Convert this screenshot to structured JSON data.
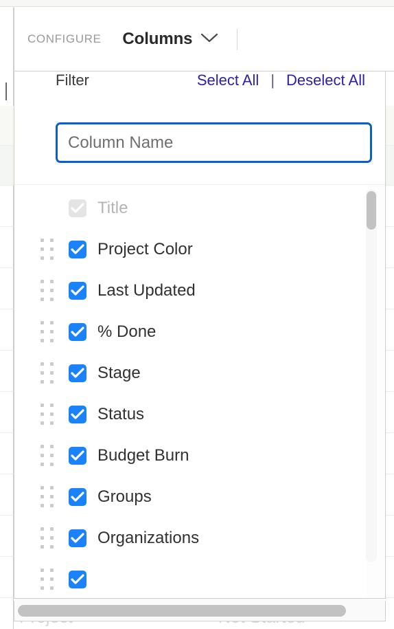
{
  "toolbar": {
    "configure_label": "CONFIGURE",
    "menu_label": "Columns",
    "chevron_icon": "chevron-down-icon"
  },
  "popover": {
    "filter_label": "Filter",
    "select_all_label": "Select All",
    "separator": "|",
    "deselect_all_label": "Deselect All",
    "search": {
      "value": "",
      "placeholder": "Column Name"
    },
    "items": [
      {
        "label": "Title",
        "checked": true,
        "disabled": true,
        "draggable": false
      },
      {
        "label": "Project Color",
        "checked": true,
        "disabled": false,
        "draggable": true
      },
      {
        "label": "Last Updated",
        "checked": true,
        "disabled": false,
        "draggable": true
      },
      {
        "label": "% Done",
        "checked": true,
        "disabled": false,
        "draggable": true
      },
      {
        "label": "Stage",
        "checked": true,
        "disabled": false,
        "draggable": true
      },
      {
        "label": "Status",
        "checked": true,
        "disabled": false,
        "draggable": true
      },
      {
        "label": "Budget Burn",
        "checked": true,
        "disabled": false,
        "draggable": true
      },
      {
        "label": "Groups",
        "checked": true,
        "disabled": false,
        "draggable": true
      },
      {
        "label": "Organizations",
        "checked": true,
        "disabled": false,
        "draggable": true
      },
      {
        "label": "",
        "checked": true,
        "disabled": false,
        "draggable": true
      }
    ]
  },
  "background": {
    "row_text_project": "Project",
    "row_text_status": "Not Started"
  },
  "colors": {
    "accent_blue": "#1a82fb",
    "link_blue": "#2d20a8",
    "input_border": "#0b5ed0",
    "text_primary": "#313131",
    "text_muted": "#b4b4b4",
    "scrollbar": "#c2c2c2"
  }
}
